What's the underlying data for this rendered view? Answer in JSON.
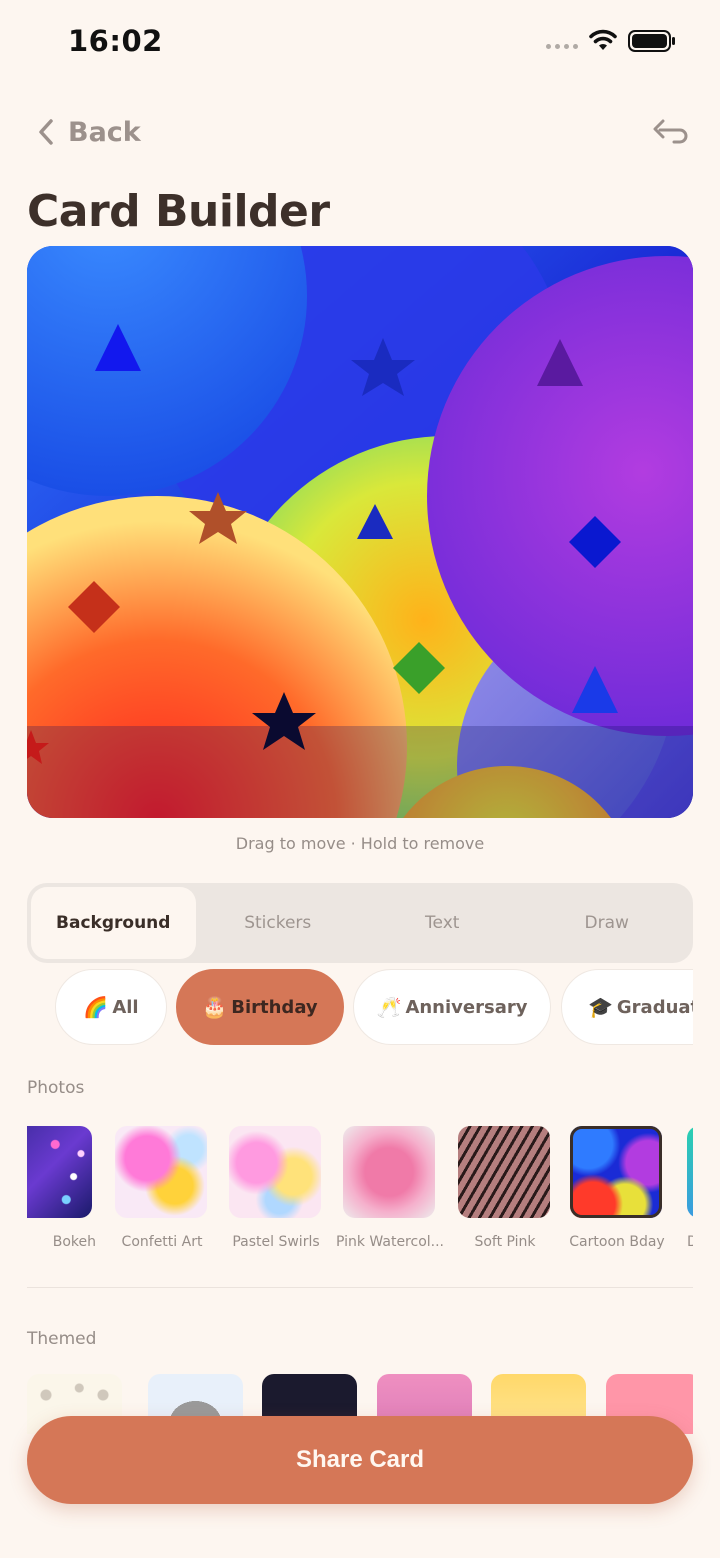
{
  "status_bar": {
    "time": "16:02"
  },
  "nav": {
    "back_label": "Back"
  },
  "page": {
    "title": "Card Builder"
  },
  "hint": "Drag to move · Hold to remove",
  "tabs": [
    {
      "label": "Background",
      "active": true
    },
    {
      "label": "Stickers",
      "active": false
    },
    {
      "label": "Text",
      "active": false
    },
    {
      "label": "Draw",
      "active": false
    }
  ],
  "chips": [
    {
      "emoji": "🌈",
      "label": "All",
      "active": false
    },
    {
      "emoji": "🎂",
      "label": "Birthday",
      "active": true
    },
    {
      "emoji": "🥂",
      "label": "Anniversary",
      "active": false
    },
    {
      "emoji": "🎓",
      "label": "Graduat",
      "active": false
    }
  ],
  "photos": {
    "title": "Photos",
    "items": [
      {
        "label": "Bokeh"
      },
      {
        "label": "Confetti Art"
      },
      {
        "label": "Pastel Swirls"
      },
      {
        "label": "Pink Watercol..."
      },
      {
        "label": "Soft Pink"
      },
      {
        "label": "Cartoon Bday",
        "selected": true
      },
      {
        "label": "D"
      }
    ]
  },
  "themed": {
    "title": "Themed"
  },
  "share_button": {
    "label": "Share Card"
  },
  "colors": {
    "accent": "#d57757",
    "background": "#fdf6f0",
    "title": "#3d302a"
  }
}
